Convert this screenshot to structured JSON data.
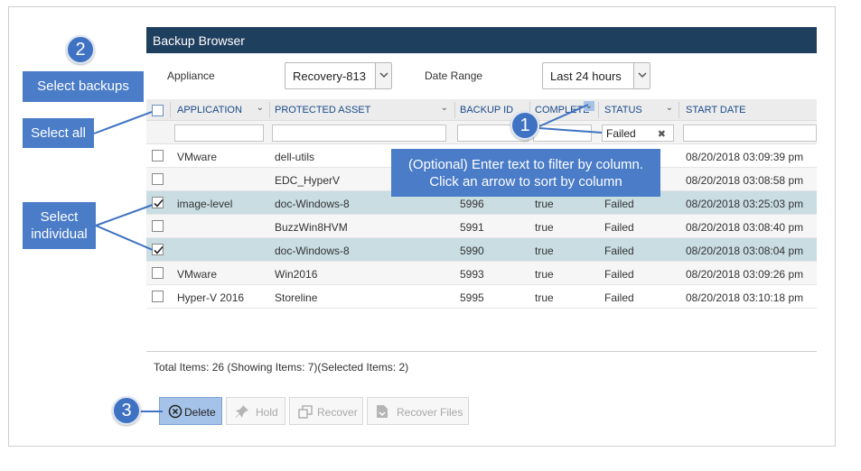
{
  "panel": {
    "title": "Backup Browser"
  },
  "filters": {
    "appliance_label": "Appliance",
    "appliance_value": "Recovery-813",
    "date_range_label": "Date Range",
    "date_range_value": "Last 24 hours"
  },
  "columns": [
    "APPLICATION",
    "PROTECTED ASSET",
    "BACKUP ID",
    "COMPLETE",
    "STATUS",
    "START DATE"
  ],
  "column_filters": {
    "status": "Failed"
  },
  "rows": [
    {
      "application": "VMware",
      "asset": "dell-utils",
      "backup_id": "",
      "complete": "",
      "status": "",
      "start": "08/20/2018 03:09:39 pm",
      "checked": false
    },
    {
      "application": "",
      "asset": "EDC_HyperV",
      "backup_id": "",
      "complete": "",
      "status": "",
      "start": "08/20/2018 03:08:58 pm",
      "checked": false
    },
    {
      "application": "image-level",
      "asset": "doc-Windows-8",
      "backup_id": "5996",
      "complete": "true",
      "status": "Failed",
      "start": "08/20/2018 03:25:03 pm",
      "checked": true
    },
    {
      "application": "",
      "asset": "BuzzWin8HVM",
      "backup_id": "5991",
      "complete": "true",
      "status": "Failed",
      "start": "08/20/2018 03:08:40 pm",
      "checked": false
    },
    {
      "application": "",
      "asset": "doc-Windows-8",
      "backup_id": "5990",
      "complete": "true",
      "status": "Failed",
      "start": "08/20/2018 03:08:04 pm",
      "checked": true
    },
    {
      "application": "VMware",
      "asset": "Win2016",
      "backup_id": "5993",
      "complete": "true",
      "status": "Failed",
      "start": "08/20/2018 03:09:26 pm",
      "checked": false
    },
    {
      "application": "Hyper-V 2016",
      "asset": "Storeline",
      "backup_id": "5995",
      "complete": "true",
      "status": "Failed",
      "start": "08/20/2018 03:10:18 pm",
      "checked": false
    }
  ],
  "footer": {
    "total": "Total Items: 26 (Showing Items: 7)(Selected Items: 2)"
  },
  "actions": {
    "delete": "Delete",
    "hold": "Hold",
    "recover": "Recover",
    "recover_files": "Recover Files"
  },
  "callouts": {
    "c1_num": "1",
    "c1_text_line1": "(Optional) Enter text to filter by column.",
    "c1_text_line2": "Click an arrow to sort by column",
    "c2_num": "2",
    "c2_text": "Select backups",
    "select_all": "Select all",
    "select_individual_line1": "Select",
    "select_individual_line2": "individual",
    "c3_num": "3"
  },
  "colors": {
    "header_bg": "#1f3f5f",
    "callout": "#4a7cc8",
    "selected_row": "#c9dde2"
  },
  "icons": [
    "chevron-down-icon",
    "checkbox-icon",
    "clear-icon",
    "delete-icon",
    "pin-icon",
    "recover-icon",
    "file-icon"
  ]
}
